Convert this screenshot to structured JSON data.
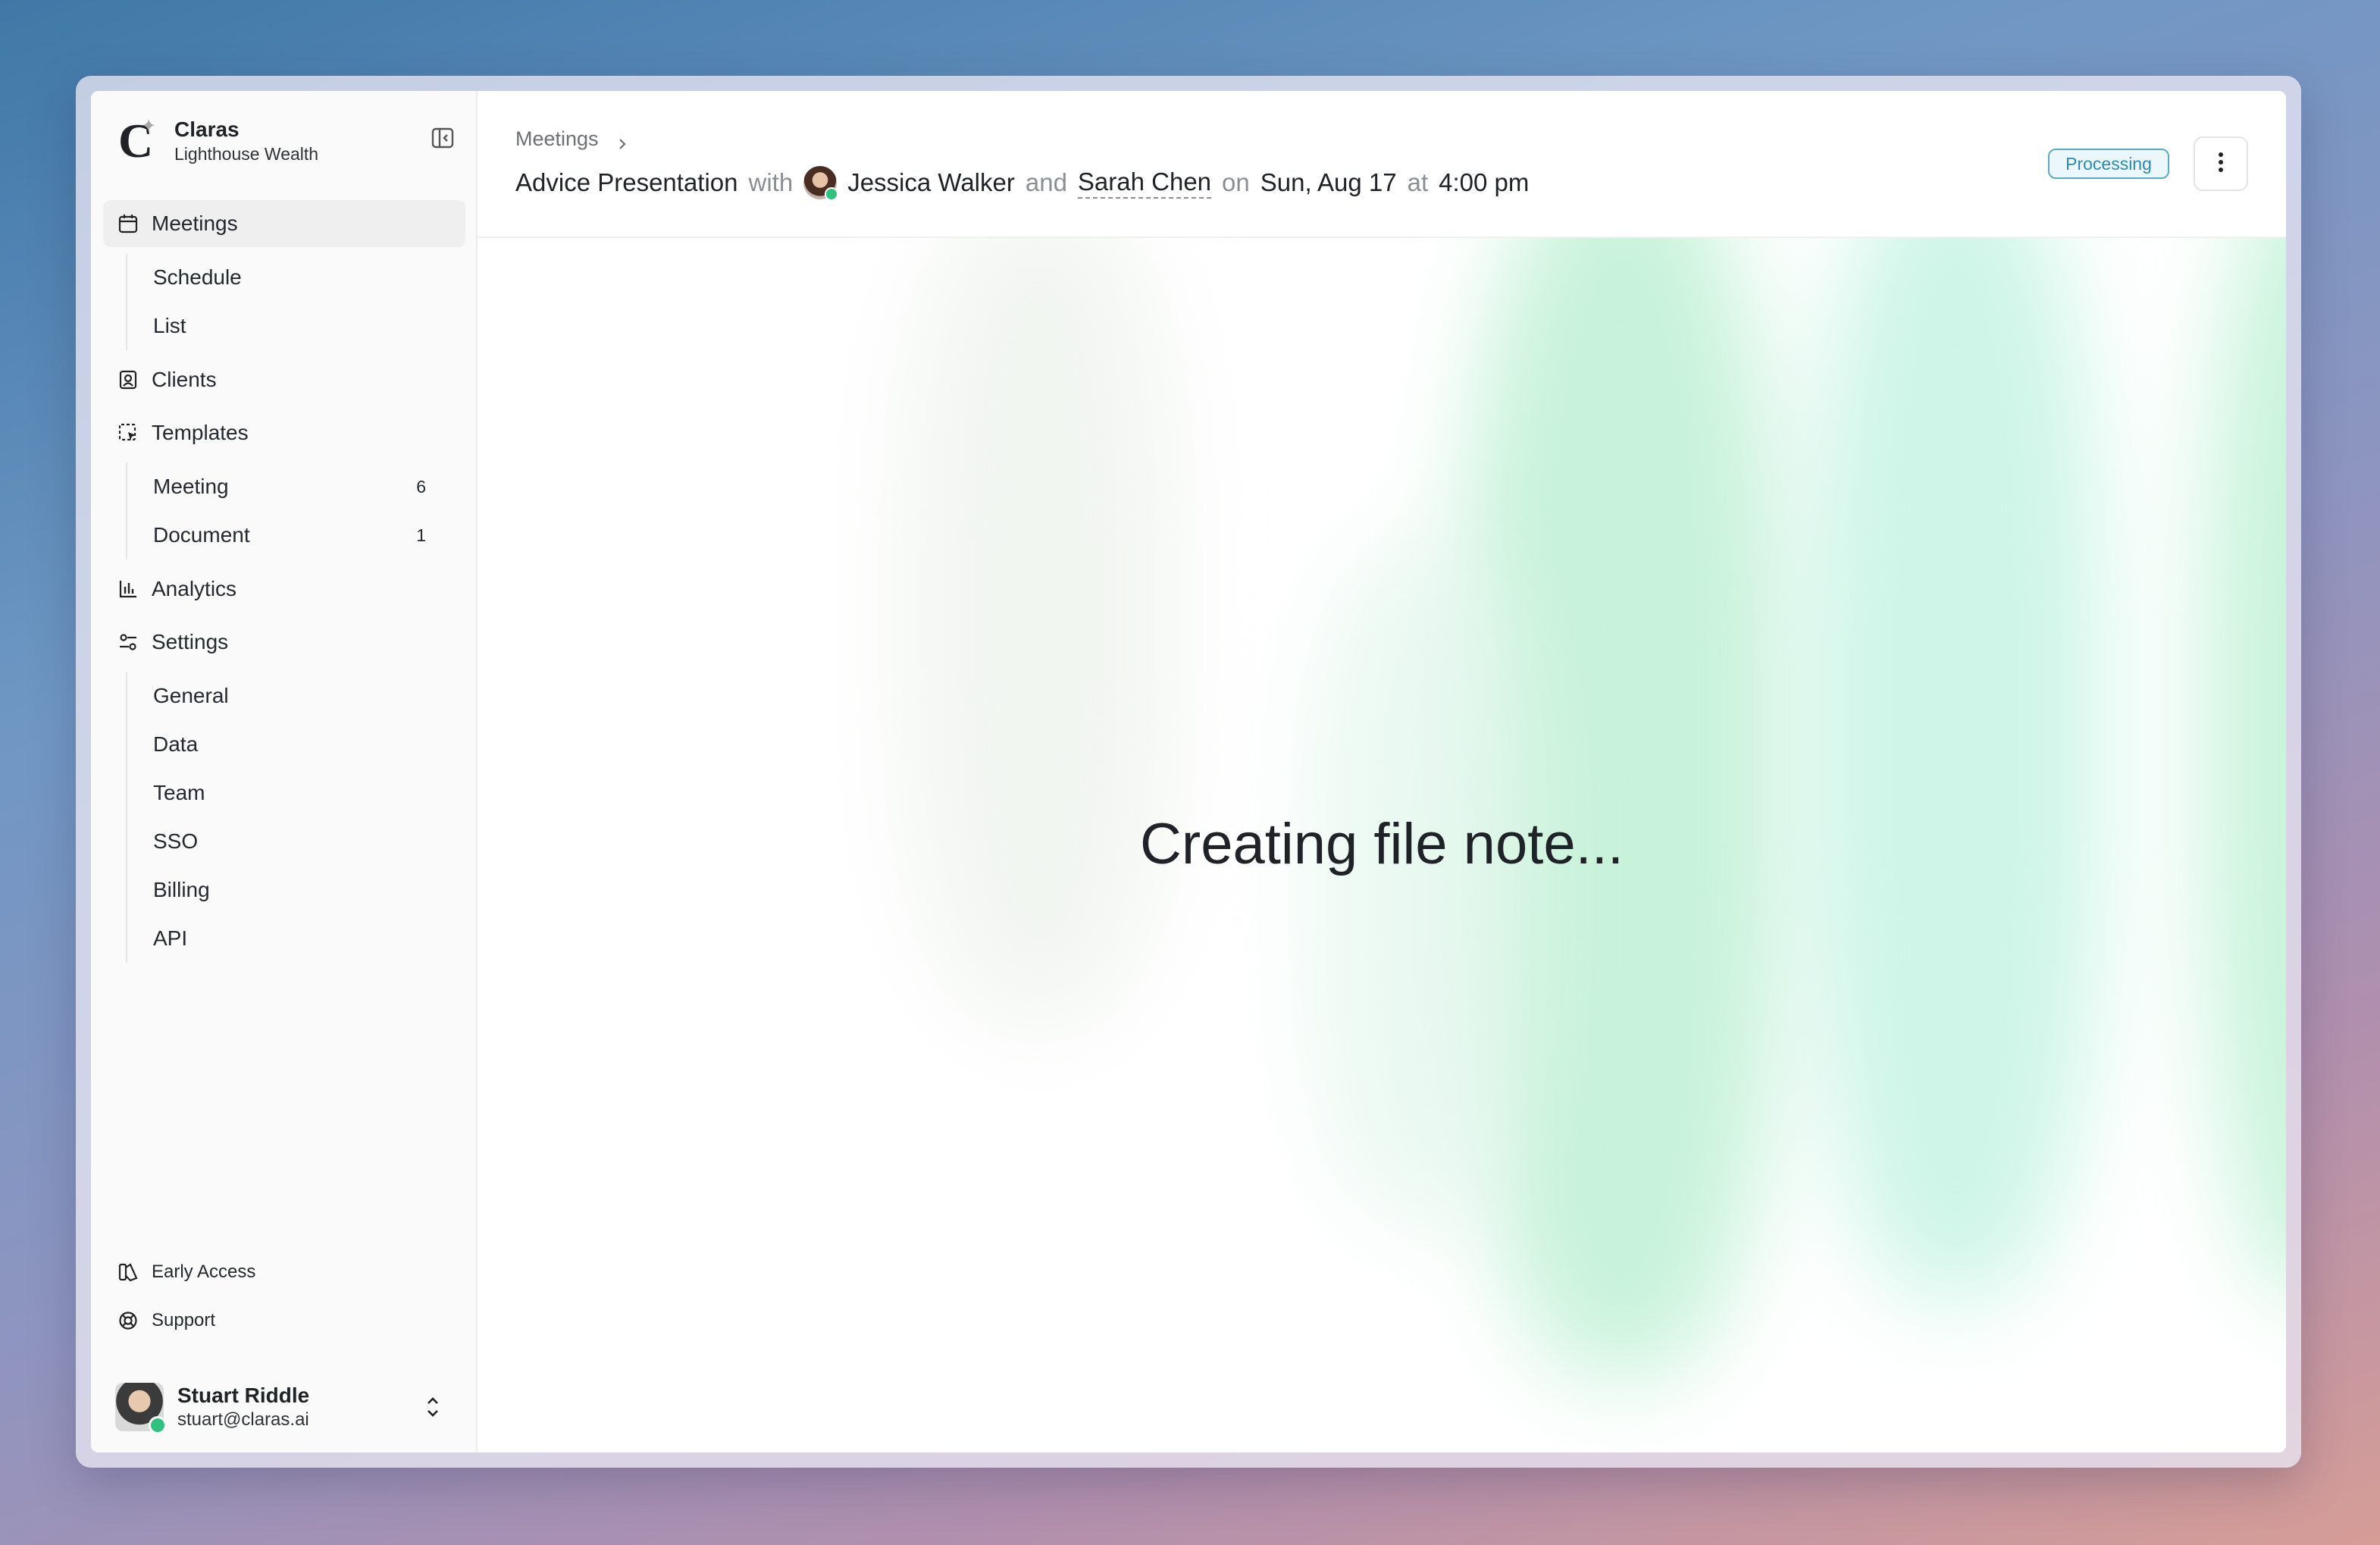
{
  "brand": {
    "name": "Claras",
    "org": "Lighthouse Wealth",
    "logo_letter": "C",
    "icon": "claras-logo"
  },
  "sidebar": {
    "collapse_icon": "sidebar-collapse-icon",
    "nav": [
      {
        "label": "Meetings",
        "icon": "calendar-icon",
        "active": true,
        "children": [
          {
            "label": "Schedule"
          },
          {
            "label": "List"
          }
        ]
      },
      {
        "label": "Clients",
        "icon": "contact-icon"
      },
      {
        "label": "Templates",
        "icon": "template-select-icon",
        "children": [
          {
            "label": "Meeting",
            "count": "6"
          },
          {
            "label": "Document",
            "count": "1"
          }
        ]
      },
      {
        "label": "Analytics",
        "icon": "bar-chart-icon"
      },
      {
        "label": "Settings",
        "icon": "settings-sliders-icon",
        "children": [
          {
            "label": "General"
          },
          {
            "label": "Data"
          },
          {
            "label": "Team"
          },
          {
            "label": "SSO"
          },
          {
            "label": "Billing"
          },
          {
            "label": "API"
          }
        ]
      }
    ],
    "bottom_links": [
      {
        "label": "Early Access",
        "icon": "early-access-icon"
      },
      {
        "label": "Support",
        "icon": "lifebuoy-icon"
      }
    ],
    "user": {
      "name": "Stuart Riddle",
      "email": "stuart@claras.ai",
      "status": "online"
    }
  },
  "header": {
    "breadcrumb": "Meetings",
    "title": {
      "meeting": "Advice Presentation",
      "with_word": "with",
      "attendee1": "Jessica Walker",
      "and_word": "and",
      "attendee2": "Sarah Chen",
      "on_word": "on",
      "date": "Sun, Aug 17",
      "at_word": "at",
      "time": "4:00 pm"
    },
    "status_badge": "Processing"
  },
  "main": {
    "status_text": "Creating file note..."
  },
  "colors": {
    "accent_badge": "#2b8ab0",
    "online": "#2ec27e",
    "glow_green": "#bff0d6"
  }
}
